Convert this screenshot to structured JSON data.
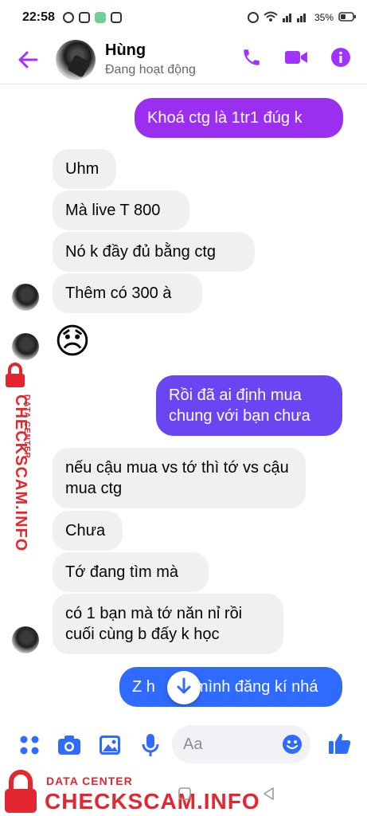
{
  "status_bar": {
    "time": "22:58",
    "battery": "35%"
  },
  "header": {
    "name": "Hùng",
    "status": "Đang hoạt động"
  },
  "colors": {
    "accent": "#a033ff",
    "outgoing_purple": "#8e2de2",
    "outgoing_blue": "#2f6bff",
    "watermark_red": "#e3262f"
  },
  "messages": [
    {
      "from": "me",
      "text": "Khoá ctg là 1tr1 đúg k"
    },
    {
      "from": "them",
      "text": "Uhm"
    },
    {
      "from": "them",
      "text": "Mà live T 800"
    },
    {
      "from": "them",
      "text": "Nó k đầy đủ bằng ctg"
    },
    {
      "from": "them",
      "text": "Thêm có 300 à"
    },
    {
      "from": "them",
      "text": "😞"
    },
    {
      "from": "me",
      "text": "Rồi đã ai định mua chung với bạn chưa"
    },
    {
      "from": "them",
      "text": "nếu cậu mua vs tớ thì tớ vs cậu mua ctg"
    },
    {
      "from": "them",
      "text": "Chưa"
    },
    {
      "from": "them",
      "text": "Tớ đang tìm mà"
    },
    {
      "from": "them",
      "text": "có 1 bạn mà tớ năn nỉ rồi cuối cùng b đấy k học"
    },
    {
      "from": "me",
      "text": "Z h         mình đăng kí nhá"
    }
  ],
  "composer": {
    "placeholder": "Aa"
  },
  "icons": [
    "back-arrow-icon",
    "phone-icon",
    "video-icon",
    "info-icon",
    "menu-dots-icon",
    "camera-icon",
    "image-icon",
    "mic-icon",
    "emoji-icon",
    "like-icon",
    "chevron-down-icon",
    "lock-icon"
  ],
  "watermark": {
    "line1": "DATA CENTER",
    "line2": "CHECKSCAM.INFO"
  }
}
